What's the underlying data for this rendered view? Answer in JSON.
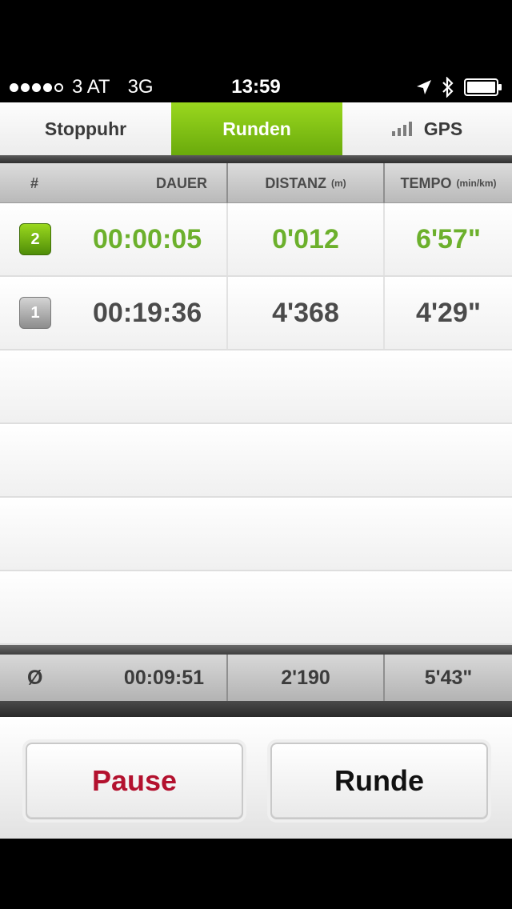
{
  "status_bar": {
    "carrier": "3 AT",
    "network": "3G",
    "time": "13:59",
    "signal_dots": 5,
    "signal_filled": 4
  },
  "tabs": [
    {
      "label": "Stoppuhr",
      "active": false
    },
    {
      "label": "Runden",
      "active": true
    },
    {
      "label": "GPS",
      "active": false,
      "icon": "signal-bars-icon"
    }
  ],
  "columns": {
    "number": "#",
    "duration": "DAUER",
    "distance": "DISTANZ",
    "distance_unit": "(m)",
    "pace": "TEMPO",
    "pace_unit": "(min/km)"
  },
  "laps": [
    {
      "number": "2",
      "duration": "00:00:05",
      "distance": "0'012",
      "pace": "6'57\"",
      "current": true
    },
    {
      "number": "1",
      "duration": "00:19:36",
      "distance": "4'368",
      "pace": "4'29\"",
      "current": false
    }
  ],
  "average": {
    "label": "Ø",
    "duration": "00:09:51",
    "distance": "2'190",
    "pace": "5'43\""
  },
  "buttons": {
    "pause": "Pause",
    "lap": "Runde"
  },
  "colors": {
    "accent_green": "#7cc016",
    "pause_red": "#b3112e"
  }
}
